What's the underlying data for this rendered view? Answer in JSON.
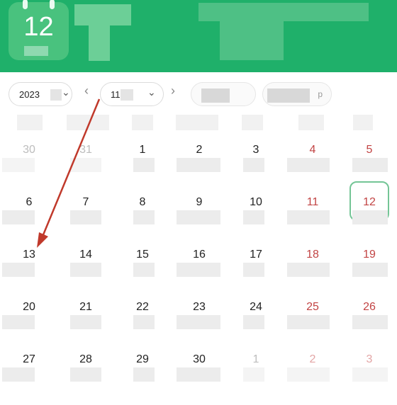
{
  "header": {
    "icon_day": "12"
  },
  "toolbar": {
    "year_value": "2023",
    "month_value": "11",
    "prev_icon": "chevron-left-icon",
    "next_icon": "chevron-right-icon",
    "pill_tail": "p"
  },
  "colors": {
    "header_bg": "#1fb06a",
    "weekend_text": "#c24444",
    "today_border": "#74c596",
    "annotation_arrow": "#c0392b"
  },
  "calendar": {
    "weeks": [
      [
        {
          "d": "30",
          "other": true
        },
        {
          "d": "31",
          "other": true
        },
        {
          "d": "1"
        },
        {
          "d": "2"
        },
        {
          "d": "3"
        },
        {
          "d": "4",
          "weekend": true
        },
        {
          "d": "5",
          "weekend": true
        }
      ],
      [
        {
          "d": "6"
        },
        {
          "d": "7"
        },
        {
          "d": "8"
        },
        {
          "d": "9"
        },
        {
          "d": "10"
        },
        {
          "d": "11",
          "weekend": true
        },
        {
          "d": "12",
          "weekend": true,
          "today": true
        }
      ],
      [
        {
          "d": "13"
        },
        {
          "d": "14"
        },
        {
          "d": "15"
        },
        {
          "d": "16"
        },
        {
          "d": "17"
        },
        {
          "d": "18",
          "weekend": true
        },
        {
          "d": "19",
          "weekend": true
        }
      ],
      [
        {
          "d": "20"
        },
        {
          "d": "21"
        },
        {
          "d": "22"
        },
        {
          "d": "23"
        },
        {
          "d": "24"
        },
        {
          "d": "25",
          "weekend": true
        },
        {
          "d": "26",
          "weekend": true
        }
      ],
      [
        {
          "d": "27"
        },
        {
          "d": "28"
        },
        {
          "d": "29"
        },
        {
          "d": "30"
        },
        {
          "d": "1",
          "other": true
        },
        {
          "d": "2",
          "other": true,
          "weekend": true
        },
        {
          "d": "3",
          "other": true,
          "weekend": true
        }
      ]
    ]
  }
}
